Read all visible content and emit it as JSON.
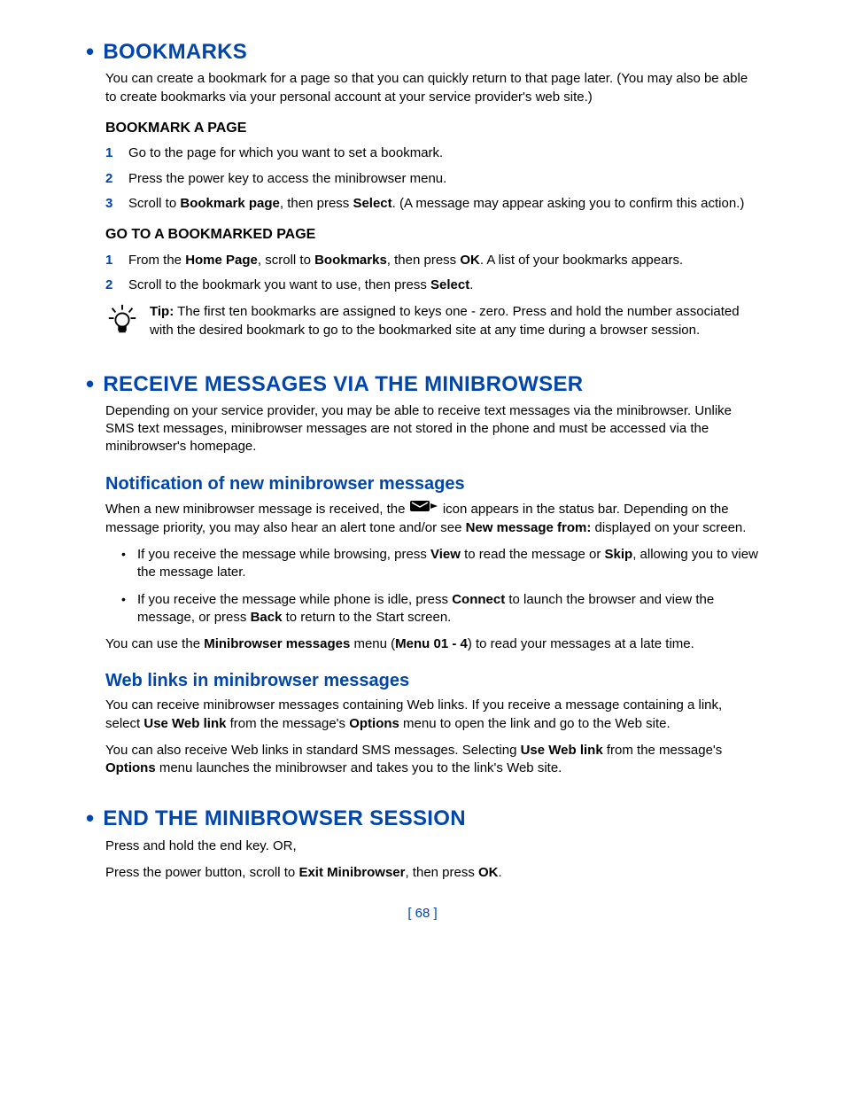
{
  "page_number": "[ 68 ]",
  "s1": {
    "title": "Bookmarks",
    "intro": "You can create a bookmark for a page so that you can quickly return to that page later. (You may also be able to create bookmarks via your personal account at your service provider's web site.)",
    "sub1": {
      "title": "Bookmark a page",
      "i1": "Go to the page for which you want to set a bookmark.",
      "i2": "Press the power key to access the minibrowser menu.",
      "i3a": "Scroll to ",
      "i3b": "Bookmark page",
      "i3c": ", then press ",
      "i3d": "Select",
      "i3e": ". (A message may appear asking you to confirm this action.)"
    },
    "sub2": {
      "title": "Go to a bookmarked page",
      "i1a": "From the ",
      "i1b": "Home Page",
      "i1c": ", scroll to ",
      "i1d": "Bookmarks",
      "i1e": ", then press ",
      "i1f": "OK",
      "i1g": ". A list of your bookmarks appears.",
      "i2a": "Scroll to the bookmark you want to use, then press ",
      "i2b": "Select",
      "i2c": ".",
      "tip_label": "Tip:",
      "tip_text": " The first ten bookmarks are assigned to keys one - zero. Press and hold the number associated with the desired bookmark to go to the bookmarked site at any time during a browser session."
    }
  },
  "s2": {
    "title": "Receive messages via the minibrowser",
    "intro": "Depending on your service provider, you may be able to receive text messages via the minibrowser. Unlike SMS text messages, minibrowser messages are not stored in the phone and must be accessed via the minibrowser's homepage.",
    "sub1": {
      "title": "Notification of new minibrowser messages",
      "p1a": "When a new minibrowser message is received, the ",
      "p1b": " icon appears in the status bar. Depending on the message priority, you may also hear an alert tone and/or see ",
      "p1c": "New message from:",
      "p1d": " displayed on your screen.",
      "b1a": "If you receive the message while browsing, press ",
      "b1b": "View",
      "b1c": " to read the message or ",
      "b1d": "Skip",
      "b1e": ", allowing you to view the message later.",
      "b2a": "If you receive the message while phone is idle, press ",
      "b2b": "Connect",
      "b2c": " to launch the browser and view the message, or press ",
      "b2d": "Back",
      "b2e": " to return to the Start screen.",
      "p2a": "You can use the ",
      "p2b": "Minibrowser messages",
      "p2c": " menu (",
      "p2d": "Menu 01 - 4",
      "p2e": ") to read your messages at a late time."
    },
    "sub2": {
      "title": "Web links in minibrowser messages",
      "p1a": "You can receive minibrowser messages containing Web links. If you receive a message containing a link, select ",
      "p1b": "Use Web link",
      "p1c": " from the message's ",
      "p1d": "Options",
      "p1e": " menu to open the link and go to the Web site.",
      "p2a": "You can also receive Web links in standard SMS messages. Selecting ",
      "p2b": "Use Web link",
      "p2c": " from the message's ",
      "p2d": "Options",
      "p2e": " menu launches the minibrowser and takes you to the link's Web site."
    }
  },
  "s3": {
    "title": "End the minibrowser session",
    "p1": "Press and hold the end key. OR,",
    "p2a": "Press the power button, scroll to ",
    "p2b": "Exit Minibrowser",
    "p2c": ", then press ",
    "p2d": "OK",
    "p2e": "."
  }
}
